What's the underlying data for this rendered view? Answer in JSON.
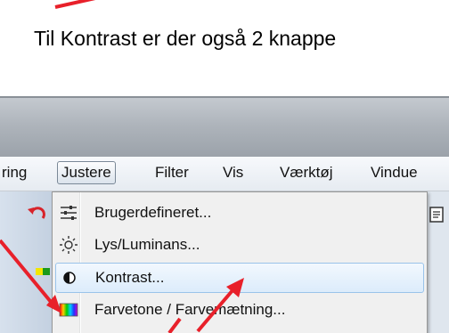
{
  "instruction": "Til Kontrast er der også 2 knappe",
  "menubar": {
    "items": [
      {
        "label": "ring"
      },
      {
        "label": "Justere"
      },
      {
        "label": "Filter"
      },
      {
        "label": "Vis"
      },
      {
        "label": "Værktøj"
      },
      {
        "label": "Vindue"
      }
    ]
  },
  "dropdown": {
    "items": [
      {
        "label": "Brugerdefineret...",
        "icon": "sliders-icon"
      },
      {
        "label": "Lys/Luminans...",
        "icon": "sun-icon"
      },
      {
        "label": "Kontrast...",
        "icon": "contrast-icon",
        "highlighted": true
      },
      {
        "label": "Farvetone / Farvemætning...",
        "icon": "rainbow-icon"
      }
    ]
  },
  "colors": {
    "annotation_arrow": "#e8202a",
    "highlight_border": "#9ac3ea"
  }
}
